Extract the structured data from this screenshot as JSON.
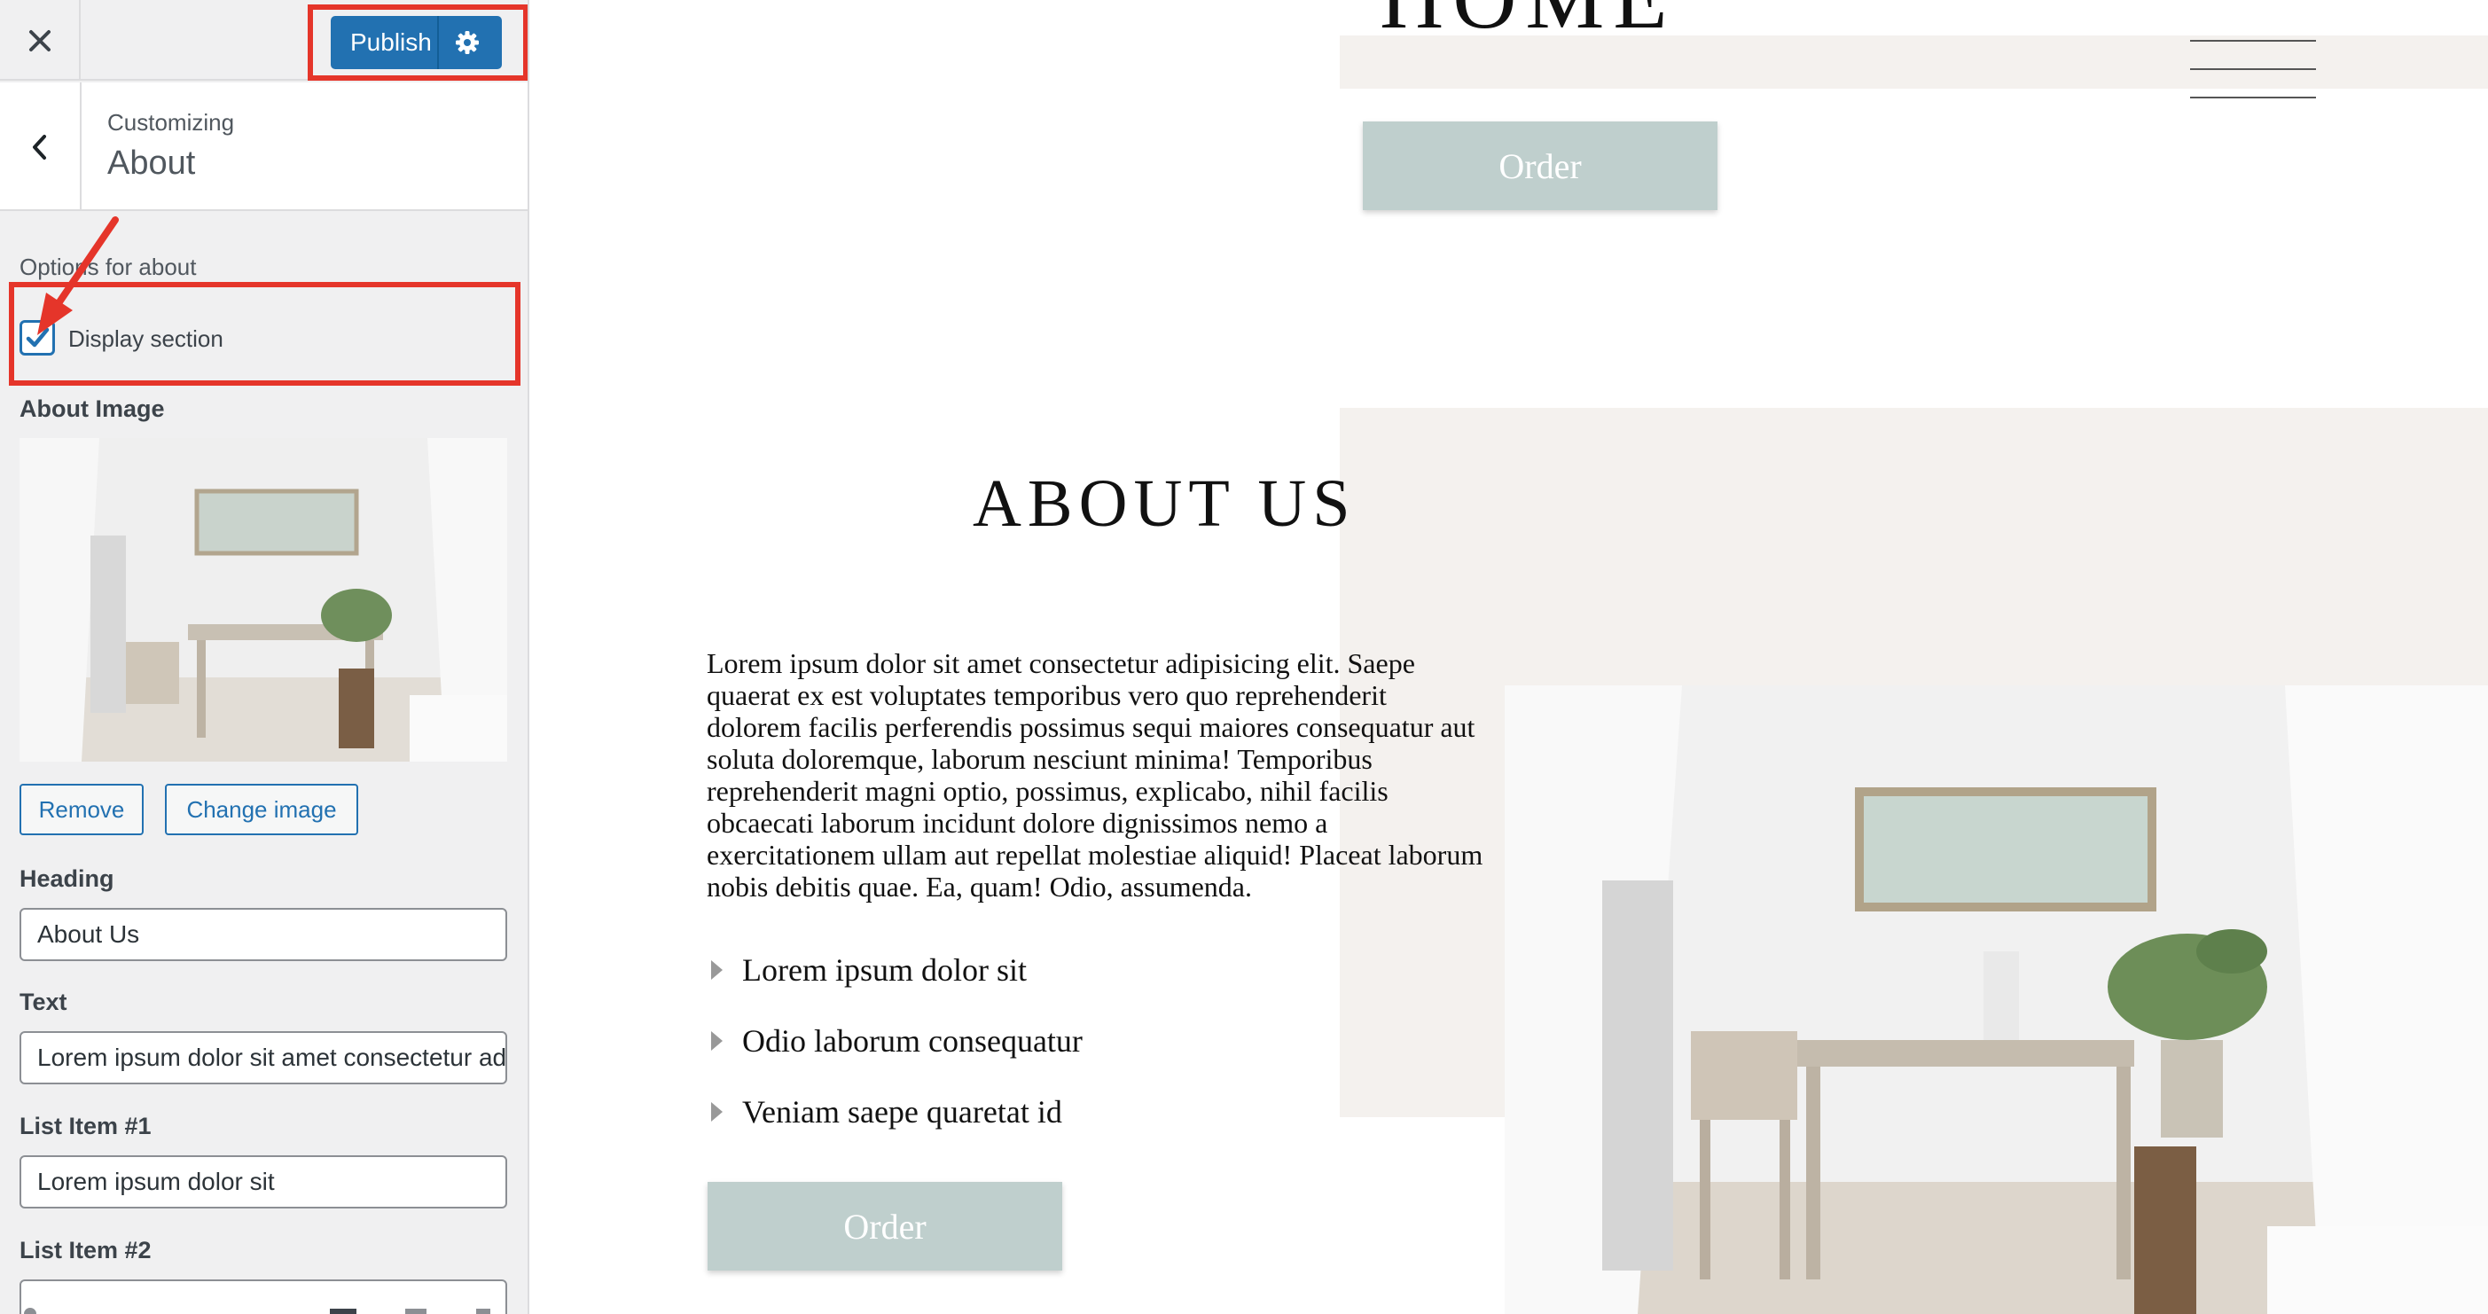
{
  "sidebar": {
    "publish_label": "Publish",
    "customizing_label": "Customizing",
    "section_title": "About",
    "options_label": "Options for about",
    "display_section": {
      "label": "Display section",
      "checked": true
    },
    "about_image_label": "About Image",
    "remove_label": "Remove",
    "change_image_label": "Change image",
    "heading_label": "Heading",
    "heading_value": "About Us",
    "text_label": "Text",
    "text_value": "Lorem ipsum dolor sit amet consectetur adipisicing elit. Saepe",
    "list_item_1_label": "List Item #1",
    "list_item_1_value": "Lorem ipsum dolor sit",
    "list_item_2_label": "List Item #2",
    "list_item_2_value": ""
  },
  "preview": {
    "home_title": "HOME",
    "order_label": "Order",
    "about_heading": "ABOUT US",
    "about_text": "Lorem ipsum dolor sit amet consectetur adipisicing elit. Saepe quaerat ex est voluptates temporibus vero quo reprehenderit dolorem facilis perferendis possimus sequi maiores consequatur aut soluta doloremque, laborum nesciunt minima! Temporibus reprehenderit magni optio, possimus, explicabo, nihil facilis obcaecati laborum incidunt dolore dignissimos nemo a exercitationem ullam aut repellat molestiae aliquid! Placeat laborum nobis debitis quae. Ea, quam! Odio, assumenda.",
    "list_items": [
      "Lorem ipsum dolor sit",
      "Odio laborum consequatur",
      "Veniam saepe quaretat id"
    ],
    "order_bottom_label": "Order"
  },
  "icons": {
    "close": "close-icon",
    "gear": "gear-icon",
    "back": "chevron-left-icon",
    "check": "checkmark-icon",
    "menu": "hamburger-menu-icon",
    "arrow": "annotation-arrow-icon"
  },
  "colors": {
    "accent": "#2271b1",
    "highlight": "#e5352a",
    "order_button": "#bfcfcd",
    "beige_panel": "#f4f1ee"
  }
}
